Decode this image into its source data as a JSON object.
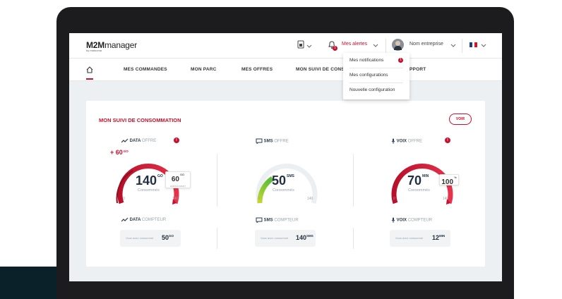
{
  "brand": {
    "logo_main": "M2M",
    "logo_rest": "manager",
    "logo_sub": "by matooma"
  },
  "topbar": {
    "alerts_label": "Mes alertes",
    "alerts_count": "1",
    "company_label": "Nom entreprise"
  },
  "dropdown": {
    "items": [
      {
        "label": "Mes notifications",
        "badge": "1"
      },
      {
        "label": "Mes configurations"
      },
      {
        "label": "Nouvelle configuration"
      }
    ]
  },
  "nav": {
    "items": [
      "MES COMMANDES",
      "MON PARC",
      "MES OFFRES",
      "MON SUIVI DE CONSO",
      "PPORT"
    ]
  },
  "card": {
    "title": "MON SUIVI DE CONSOMMATION",
    "voir_label": "VOIR"
  },
  "gauges": [
    {
      "label": "DATA",
      "sub": "OFFRE",
      "value": "140",
      "unit": "GO",
      "consumed": "Consommés",
      "min": "0",
      "max": "140",
      "extra": "+ 60",
      "extra_unit": "GO",
      "overlay": "60",
      "overlay_unit": "GO",
      "overlay_sub": "HORS FORFAIT"
    },
    {
      "label": "SMS",
      "sub": "OFFRE",
      "value": "50",
      "unit": "SMS",
      "consumed": "Consommés",
      "min": "0",
      "max": "140"
    },
    {
      "label": "VOIX",
      "sub": "OFFRE",
      "value": "70",
      "unit": "MIN",
      "consumed": "Consommés",
      "min": "0",
      "max": "140",
      "overlay": "100",
      "overlay_unit": "%"
    }
  ],
  "counters": [
    {
      "label": "DATA",
      "sub": "COMPTEUR",
      "text": "Vous avez consommé",
      "value": "50",
      "unit": "GO"
    },
    {
      "label": "SMS",
      "sub": "COMPTEUR",
      "text": "Vous avez consommé",
      "value": "140",
      "unit": "SMS"
    },
    {
      "label": "VOIX",
      "sub": "COMPTEUR",
      "text": "Vous avez consommé",
      "value": "12",
      "unit": "MIN"
    }
  ],
  "colors": {
    "accent": "#c8102e",
    "sms_gradient_start": "#c6d82c",
    "sms_gradient_end": "#5fbf3a",
    "navy": "#1f2f3f"
  }
}
